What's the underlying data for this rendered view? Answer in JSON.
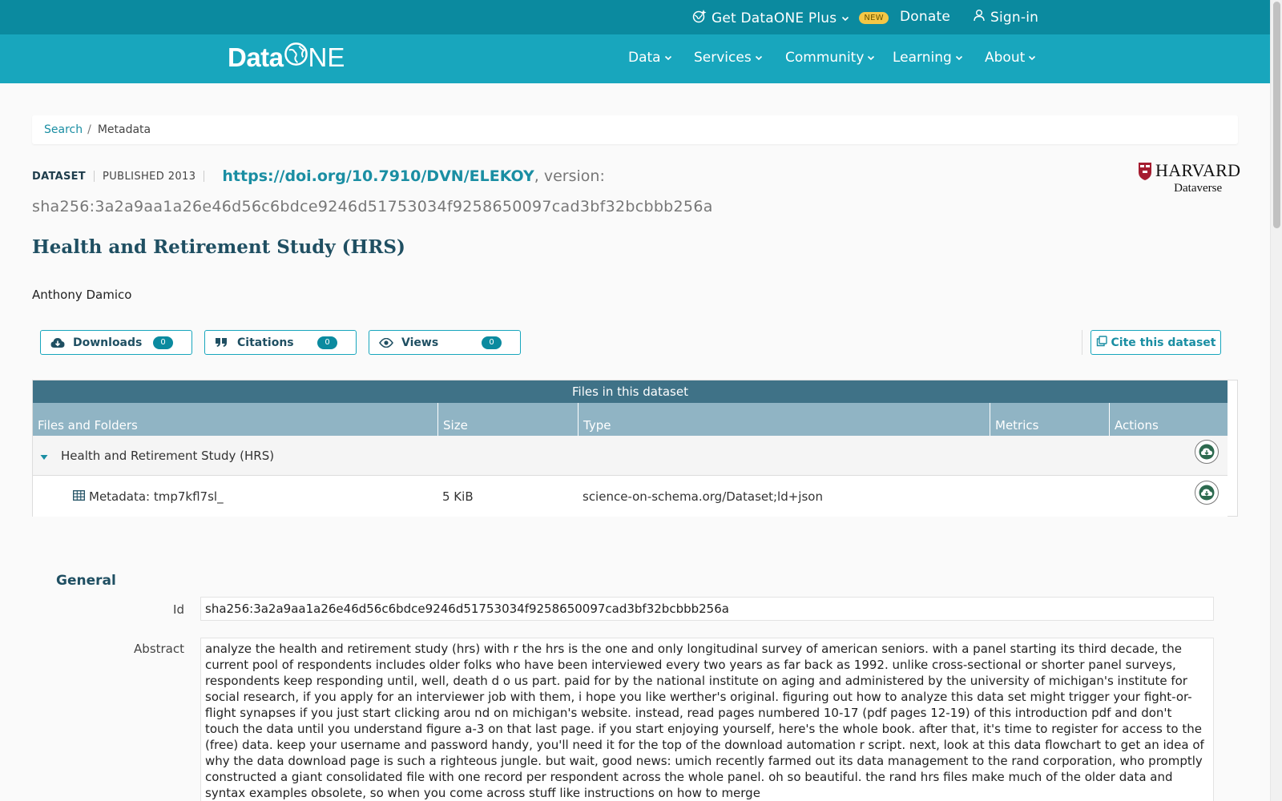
{
  "topbar": {
    "plus_label": "Get DataONE Plus",
    "new_badge": "NEW",
    "donate_label": "Donate",
    "signin_label": "Sign-in"
  },
  "logo": {
    "text_data": "Data",
    "text_one": "NE"
  },
  "nav": {
    "items": [
      {
        "label": "Data"
      },
      {
        "label": "Services"
      },
      {
        "label": "Community"
      },
      {
        "label": "Learning"
      },
      {
        "label": "About"
      }
    ]
  },
  "breadcrumb": {
    "search": "Search",
    "separator": "/",
    "current": "Metadata"
  },
  "header": {
    "type": "DATASET",
    "published": "PUBLISHED 2013",
    "doi": "https://doi.org/10.7910/DVN/ELEKOY",
    "version_label": ", version:",
    "sha": "sha256:3a2a9aa1a26e46d56c6bdce9246d51753034f9258650097cad3bf32bcbbb256a",
    "repository_name": "HARVARD",
    "repository_sub": "Dataverse"
  },
  "dataset": {
    "title": "Health and Retirement Study (HRS)",
    "author": "Anthony Damico"
  },
  "metrics": {
    "downloads_label": "Downloads",
    "downloads_count": "0",
    "citations_label": "Citations",
    "citations_count": "0",
    "views_label": "Views",
    "views_count": "0",
    "cite_label": "Cite this dataset"
  },
  "files": {
    "title": "Files in this dataset",
    "columns": [
      "Files and Folders",
      "Size",
      "Type",
      "Metrics",
      "Actions"
    ],
    "folder": {
      "name": "Health and Retirement Study (HRS)"
    },
    "rows": [
      {
        "name": "Metadata: tmp7kfl7sl_",
        "size": "5 KiB",
        "type": "science-on-schema.org/Dataset;ld+json"
      }
    ]
  },
  "general": {
    "heading": "General",
    "id_label": "Id",
    "id_value": "sha256:3a2a9aa1a26e46d56c6bdce9246d51753034f9258650097cad3bf32bcbbb256a",
    "abstract_label": "Abstract",
    "abstract_value": "analyze the health and retirement study (hrs) with r the hrs is the one and only longitudinal survey of american seniors. with a panel starting its third decade, the current pool of respondents includes older folks who have been interviewed every two years as far back as 1992. unlike cross-sectional or shorter panel surveys, respondents keep responding until, well, death d o us part. paid for by the national institute on aging and administered by the university of michigan's institute for social research, if you apply for an interviewer job with them, i hope you like werther's original. figuring out how to analyze this data set might trigger your fight-or-flight synapses if you just start clicking arou nd on michigan's website. instead, read pages numbered 10-17 (pdf pages 12-19) of this introduction pdf and don't touch the data until you understand figure a-3 on that last page. if you start enjoying yourself, here's the whole book. after that, it's time to register for access to the (free) data. keep your username and password handy, you'll need it for the top of the download automation r script. next, look at this data flowchart to get an idea of why the data download page is such a righteous jungle. but wait, good news: umich recently farmed out its data management to the rand corporation, who promptly constructed a giant consolidated file with one record per respondent across the whole panel. oh so beautiful. the rand hrs files make much of the older data and syntax examples obsolete, so when you come across stuff like instructions on how to merge"
  },
  "colors": {
    "topbar": "#0b8a9f",
    "navbar": "#18a6bd",
    "accent": "#1a8ea3",
    "table_header": "#3f7287",
    "table_cols": "#90b4c4"
  }
}
